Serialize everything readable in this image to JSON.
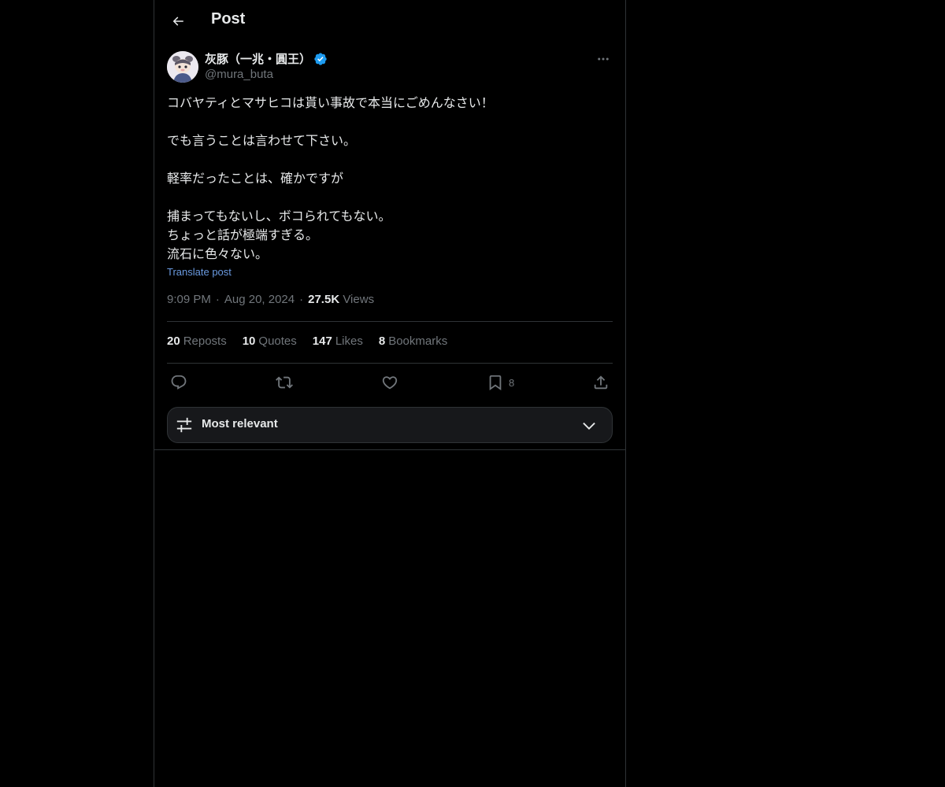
{
  "header": {
    "title": "Post",
    "back_icon": "arrow-left-icon"
  },
  "author": {
    "display_name": "灰豚（一兆・圓王）",
    "handle": "@mura_buta",
    "verified": true,
    "avatar_icon": "avatar-illustration"
  },
  "post": {
    "lines": [
      "コバヤティとマサヒコは貰い事故で本当にごめんなさい！",
      "",
      "でも言うことは言わせて下さい。",
      "",
      "軽率だったことは、確かですが",
      "",
      "捕まってもないし、ボコられてもない。",
      "ちょっと話が極端すぎる。",
      "流石に色々ない。"
    ],
    "translate_label": "Translate post",
    "time": "9:09 PM",
    "date": "Aug 20, 2024",
    "views_count": "27.5K",
    "views_label": "Views"
  },
  "stats": {
    "reposts_count": "20",
    "reposts_label": "Reposts",
    "quotes_count": "10",
    "quotes_label": "Quotes",
    "likes_count": "147",
    "likes_label": "Likes",
    "bookmarks_count": "8",
    "bookmarks_label": "Bookmarks"
  },
  "actions": {
    "bookmark_count": "8"
  },
  "sort": {
    "label": "Most relevant"
  },
  "colors": {
    "background": "#000000",
    "text": "#e7e9ea",
    "muted": "#71767b",
    "link": "#6a9ae0",
    "verified": "#1d9bf0",
    "border": "#2f3336"
  }
}
